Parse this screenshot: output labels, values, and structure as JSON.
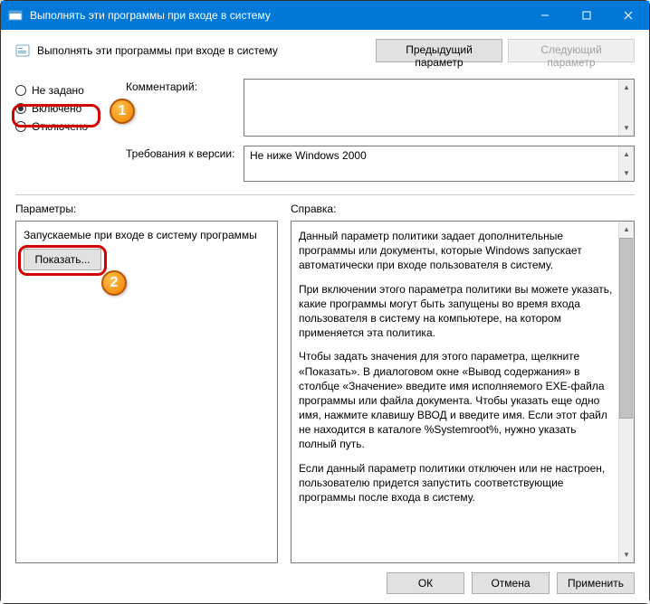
{
  "window": {
    "title": "Выполнять эти программы при входе в систему"
  },
  "header": {
    "subtitle": "Выполнять эти программы при входе в систему",
    "prev": "Предыдущий параметр",
    "next": "Следующий параметр"
  },
  "radios": {
    "not_configured": "Не задано",
    "enabled": "Включено",
    "disabled": "Отключено"
  },
  "annotations": {
    "one": "1",
    "two": "2"
  },
  "info": {
    "comment_label": "Комментарий:",
    "req_label": "Требования к версии:",
    "req_value": "Не ниже Windows 2000"
  },
  "panes": {
    "params_label": "Параметры:",
    "help_label": "Справка:",
    "params_desc": "Запускаемые при входе в систему программы",
    "show_btn": "Показать..."
  },
  "help": {
    "p1": "Данный параметр политики задает дополнительные программы или документы, которые Windows запускает автоматически при входе пользователя в систему.",
    "p2": "При включении этого параметра политики вы можете указать, какие программы могут быть запущены во время входа пользователя в систему на компьютере, на котором применяется эта политика.",
    "p3": "Чтобы задать значения для этого параметра, щелкните «Показать». В диалоговом окне «Вывод содержания» в столбце «Значение» введите имя исполняемого EXE-файла программы или файла документа. Чтобы указать еще одно имя, нажмите клавишу ВВОД и введите имя. Если этот файл не находится в каталоге %Systemroot%, нужно указать полный путь.",
    "p4": "Если данный параметр политики отключен или не настроен, пользователю придется запустить соответствующие программы после входа в систему."
  },
  "footer": {
    "ok": "ОК",
    "cancel": "Отмена",
    "apply": "Применить"
  }
}
